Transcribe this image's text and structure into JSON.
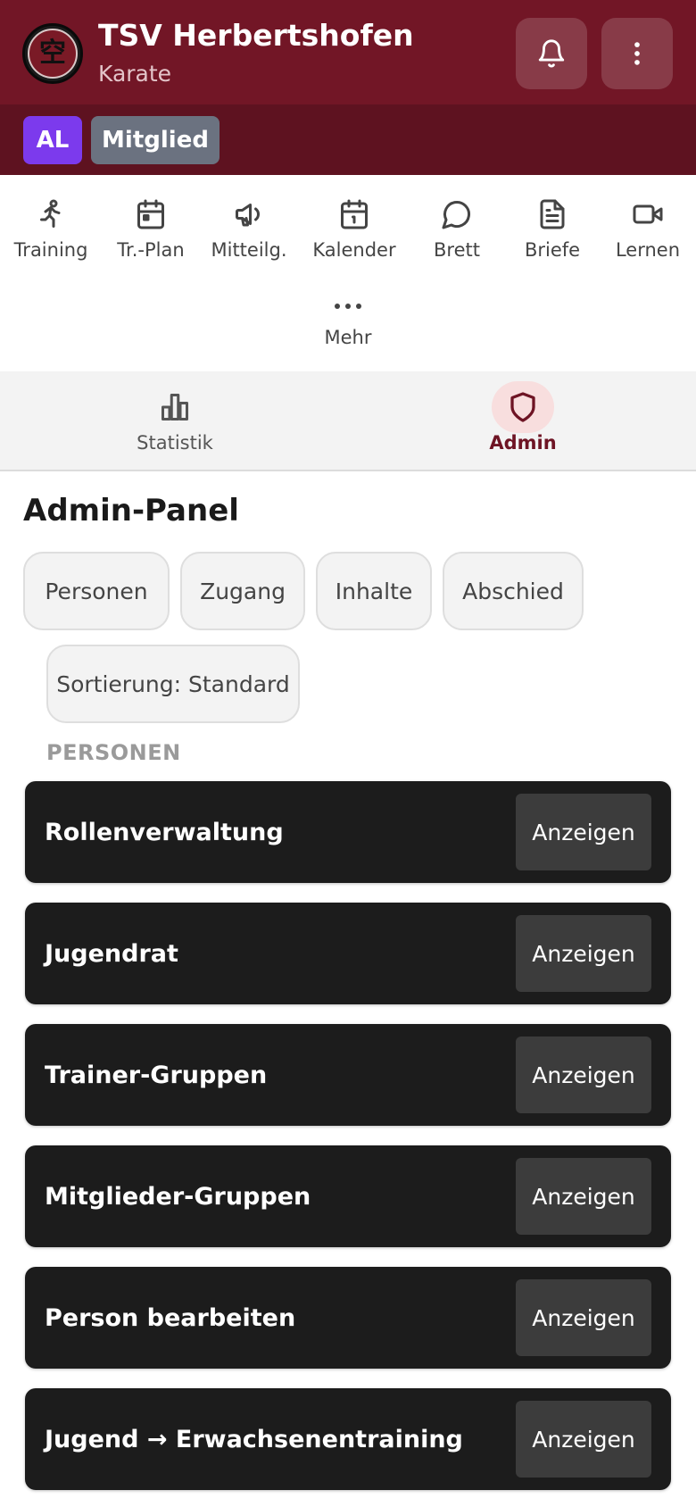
{
  "header": {
    "club_name": "TSV Herbertshofen",
    "department": "Karate",
    "bell_icon": "bell-icon",
    "more_icon": "more-vertical-icon",
    "background": "#721626"
  },
  "roles": {
    "initials": "AL",
    "member_label": "Mitglied",
    "initials_color": "#7c3aed",
    "member_color": "#6b7280"
  },
  "nav": {
    "items": [
      {
        "label": "Training",
        "icon": "running-icon"
      },
      {
        "label": "Tr.-Plan",
        "icon": "calendar-icon"
      },
      {
        "label": "Mitteilg.",
        "icon": "megaphone-icon"
      },
      {
        "label": "Kalender",
        "icon": "calendar-icon"
      },
      {
        "label": "Brett",
        "icon": "chat-bubble-icon"
      },
      {
        "label": "Briefe",
        "icon": "document-icon"
      },
      {
        "label": "Lernen",
        "icon": "video-icon"
      },
      {
        "label": "Mehr",
        "icon": "more-horizontal-icon"
      }
    ]
  },
  "tabs": [
    {
      "label": "Statistik",
      "icon": "bar-chart-icon",
      "active": false
    },
    {
      "label": "Admin",
      "icon": "shield-icon",
      "active": true
    }
  ],
  "main": {
    "title": "Admin-Panel",
    "filters": [
      "Personen",
      "Zugang",
      "Inhalte",
      "Abschied"
    ],
    "sort_label": "Sortierung: Standard",
    "section_label": "PERSONEN",
    "cards": [
      {
        "title": "Rollenverwaltung",
        "action": "Anzeigen"
      },
      {
        "title": "Jugendrat",
        "action": "Anzeigen"
      },
      {
        "title": "Trainer-Gruppen",
        "action": "Anzeigen"
      },
      {
        "title": "Mitglieder-Gruppen",
        "action": "Anzeigen"
      },
      {
        "title": "Person bearbeiten",
        "action": "Anzeigen"
      },
      {
        "title": "Jugend → Erwachsenentraining",
        "action": "Anzeigen"
      }
    ]
  }
}
